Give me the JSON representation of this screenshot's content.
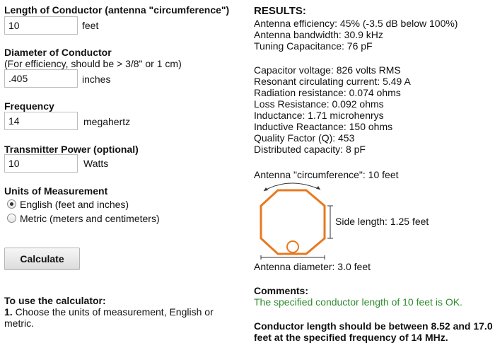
{
  "form": {
    "length_label": "Length of Conductor (antenna \"circumference\")",
    "length_value": "10",
    "length_unit": "feet",
    "diameter_label": "Diameter of Conductor",
    "diameter_hint": "(For efficiency, should be > 3/8\" or 1 cm)",
    "diameter_value": ".405",
    "diameter_unit": "inches",
    "frequency_label": "Frequency",
    "frequency_value": "14",
    "frequency_unit": "megahertz",
    "power_label": "Transmitter Power (optional)",
    "power_value": "10",
    "power_unit": "Watts",
    "units_label": "Units of Measurement",
    "units_options": [
      {
        "label": "English (feet and inches)",
        "selected": true
      },
      {
        "label": "Metric (meters and centimeters)",
        "selected": false
      }
    ],
    "calculate_label": "Calculate"
  },
  "instructions": {
    "title": "To use the calculator:",
    "step_number": "1.",
    "step_text_1": "Choose the units of measurement, English or",
    "step_text_2": "metric."
  },
  "results": {
    "title": "RESULTS:",
    "group1": [
      "Antenna efficiency: 45% (-3.5 dB below 100%)",
      "Antenna bandwidth: 30.9 kHz",
      "Tuning Capacitance: 76 pF"
    ],
    "group2": [
      "Capacitor voltage: 826 volts RMS",
      "Resonant circulating current: 5.49 A",
      "Radiation resistance: 0.074 ohms",
      "Loss Resistance: 0.092 ohms",
      "Inductance: 1.71 microhenrys",
      "Inductive Reactance: 150 ohms",
      "Quality Factor (Q): 453",
      "Distributed capacity: 8 pF"
    ],
    "circumference": "Antenna \"circumference\": 10 feet",
    "side_length": "Side length: 1.25 feet",
    "diameter": "Antenna diameter: 3.0 feet",
    "comments_title": "Comments:",
    "comment_text": "The specified conductor length of 10 feet is OK.",
    "advice_line1": "Conductor length should be between 8.52 and 17.0",
    "advice_line2": "feet at the specified frequency of 14 MHz."
  },
  "colors": {
    "octagon": "#e8791f",
    "comment": "#2e8b2e"
  }
}
